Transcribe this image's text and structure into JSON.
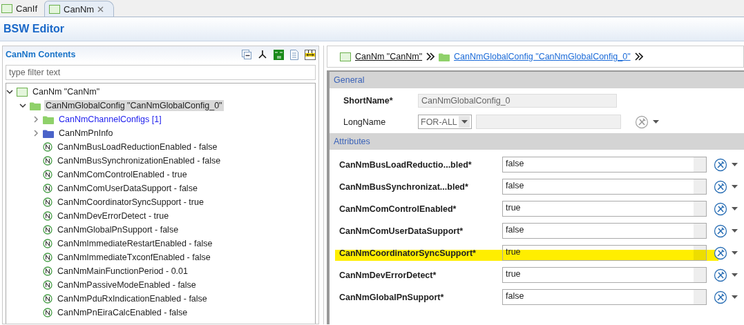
{
  "tabs": [
    {
      "label": "CanIf",
      "selected": false,
      "closable": false
    },
    {
      "label": "CanNm",
      "selected": true,
      "closable": true
    }
  ],
  "editor_title": "BSW Editor",
  "contents": {
    "title": "CanNm Contents",
    "filter": {
      "placeholder": "type filter text"
    },
    "tree": [
      {
        "kind": "module",
        "label": "CanNm \"CanNm\"",
        "expanded": true,
        "selected": false,
        "children": [
          {
            "kind": "folder",
            "color": "#8fd16a",
            "label": "CanNmGlobalConfig \"CanNmGlobalConfig_0\"",
            "expanded": true,
            "selected": true,
            "children": [
              {
                "kind": "folder",
                "color": "#8fd16a",
                "label": "CanNmChannelConfigs [1]",
                "link": true,
                "expanded": false,
                "selected": false
              },
              {
                "kind": "folder",
                "color": "#4a63c9",
                "label": "CanNmPnInfo",
                "expanded": false,
                "selected": false
              },
              {
                "kind": "param",
                "label": "CanNmBusLoadReductionEnabled - false",
                "selected": false
              },
              {
                "kind": "param",
                "label": "CanNmBusSynchronizationEnabled - false",
                "selected": false
              },
              {
                "kind": "param",
                "label": "CanNmComControlEnabled - true",
                "selected": false
              },
              {
                "kind": "param",
                "label": "CanNmComUserDataSupport - false",
                "selected": false
              },
              {
                "kind": "param",
                "label": "CanNmCoordinatorSyncSupport - true",
                "selected": false
              },
              {
                "kind": "param",
                "label": "CanNmDevErrorDetect - true",
                "selected": false
              },
              {
                "kind": "param",
                "label": "CanNmGlobalPnSupport - false",
                "selected": false
              },
              {
                "kind": "param",
                "label": "CanNmImmediateRestartEnabled - false",
                "selected": false
              },
              {
                "kind": "param",
                "label": "CanNmImmediateTxconfEnabled - false",
                "selected": false
              },
              {
                "kind": "param",
                "label": "CanNmMainFunctionPeriod - 0.01",
                "selected": false
              },
              {
                "kind": "param",
                "label": "CanNmPassiveModeEnabled - false",
                "selected": false
              },
              {
                "kind": "param",
                "label": "CanNmPduRxIndicationEnabled - false",
                "selected": false
              },
              {
                "kind": "param",
                "label": "CanNmPnEiraCalcEnabled - false",
                "selected": false
              }
            ]
          }
        ]
      }
    ]
  },
  "breadcrumb": [
    {
      "kind": "module",
      "label": "CanNm \"CanNm\""
    },
    {
      "kind": "folder",
      "label": "CanNmGlobalConfig \"CanNmGlobalConfig_0\""
    }
  ],
  "general": {
    "title": "General",
    "short_name": {
      "label": "ShortName*",
      "value": "CanNmGlobalConfig_0"
    },
    "long_name": {
      "label": "LongName",
      "language": "FOR-ALL"
    }
  },
  "attributes": {
    "title": "Attributes",
    "rows": [
      {
        "label": "CanNmBusLoadReductio...bled*",
        "value": "false",
        "highlighted": false
      },
      {
        "label": "CanNmBusSynchronizat...bled*",
        "value": "false",
        "highlighted": false
      },
      {
        "label": "CanNmComControlEnabled*",
        "value": "true",
        "highlighted": false
      },
      {
        "label": "CanNmComUserDataSupport*",
        "value": "false",
        "highlighted": false
      },
      {
        "label": "CanNmCoordinatorSyncSupport*",
        "value": "true",
        "highlighted": true
      },
      {
        "label": "CanNmDevErrorDetect*",
        "value": "true",
        "highlighted": false
      },
      {
        "label": "CanNmGlobalPnSupport*",
        "value": "false",
        "highlighted": false
      }
    ]
  }
}
